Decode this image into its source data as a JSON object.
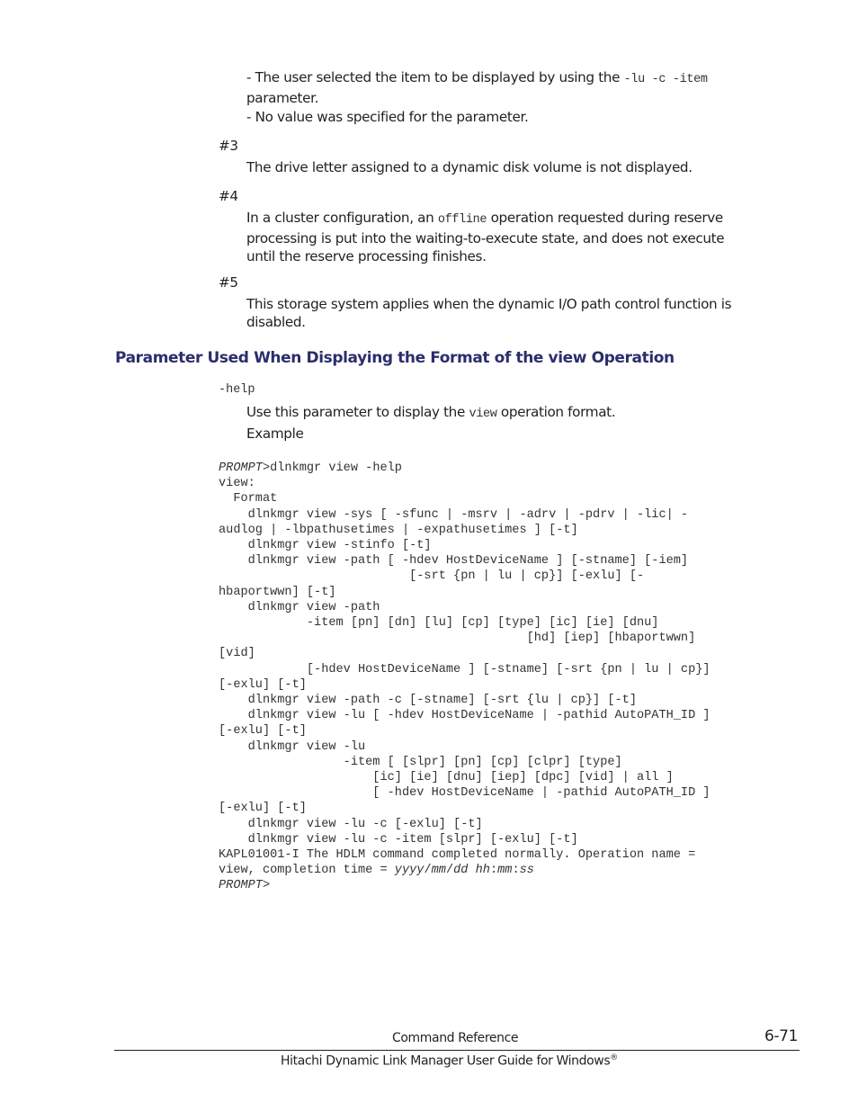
{
  "notes": {
    "bullet1_pre": "- The user selected the item to be displayed by using the ",
    "bullet1_code": "-lu -c -item",
    "bullet1_post": "parameter.",
    "bullet2": "- No value was specified for the parameter.",
    "n3_label": "#3",
    "n3_text": "The drive letter assigned to a dynamic disk volume is not displayed.",
    "n4_label": "#4",
    "n4_pre": "In a cluster configuration, an ",
    "n4_code": "offline",
    "n4_line1_post": " operation requested during reserve",
    "n4_line2": "processing is put into the waiting-to-execute state, and does not execute",
    "n4_line3": "until the reserve processing finishes.",
    "n5_label": "#5",
    "n5_line1": "This storage system applies when the dynamic I/O path control function is",
    "n5_line2": "disabled."
  },
  "section": {
    "heading": "Parameter Used When Displaying the Format of the view Operation",
    "param": "-help",
    "desc_pre": "Use this parameter to display the ",
    "desc_code": "view",
    "desc_post": " operation format.",
    "example_label": "Example"
  },
  "code": {
    "prompt": "PROMPT",
    "first_cmd": ">dlnkmgr view -help",
    "body": "view:\n  Format\n    dlnkmgr view -sys [ -sfunc | -msrv | -adrv | -pdrv | -lic| -\naudlog | -lbpathusetimes | -expathusetimes ] [-t]\n    dlnkmgr view -stinfo [-t]\n    dlnkmgr view -path [ -hdev HostDeviceName ] [-stname] [-iem]\n                          [-srt {pn | lu | cp}] [-exlu] [-\nhbaportwwn] [-t]\n    dlnkmgr view -path\n            -item [pn] [dn] [lu] [cp] [type] [ic] [ie] [dnu]\n                                          [hd] [iep] [hbaportwwn]\n[vid]\n            [-hdev HostDeviceName ] [-stname] [-srt {pn | lu | cp}]\n[-exlu] [-t]\n    dlnkmgr view -path -c [-stname] [-srt {lu | cp}] [-t]\n    dlnkmgr view -lu [ -hdev HostDeviceName | -pathid AutoPATH_ID ]\n[-exlu] [-t]\n    dlnkmgr view -lu\n                 -item [ [slpr] [pn] [cp] [clpr] [type]\n                     [ic] [ie] [dnu] [iep] [dpc] [vid] | all ]\n                     [ -hdev HostDeviceName | -pathid AutoPATH_ID ]\n[-exlu] [-t]\n    dlnkmgr view -lu -c [-exlu] [-t]\n    dlnkmgr view -lu -c -item [slpr] [-exlu] [-t]\nKAPL01001-I The HDLM command completed normally. Operation name =\nview, completion time = ",
    "time_yyyy": "yyyy",
    "time_mm": "mm",
    "time_dd": "dd",
    "time_hh": "hh",
    "time_min": "mm",
    "time_ss": "ss",
    "last_prompt": "PROMPT",
    "last_gt": ">"
  },
  "footer": {
    "chapter": "Command Reference",
    "page_number": "6-71",
    "book_title": "Hitachi Dynamic Link Manager User Guide for Windows",
    "reg_mark": "®"
  }
}
